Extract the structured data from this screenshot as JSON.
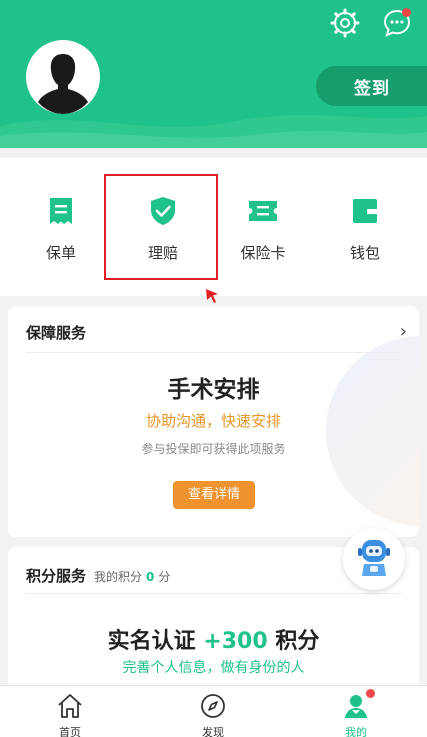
{
  "header": {
    "signin_label": "签到",
    "colors": {
      "background": "#1fc28a",
      "signin_bg": "#179c6c",
      "notify_dot": "#f04848"
    },
    "icons": [
      "settings-icon",
      "chat-icon",
      "avatar-icon"
    ]
  },
  "quick_actions": [
    {
      "label": "保单",
      "icon": "policy-icon"
    },
    {
      "label": "理赔",
      "icon": "claim-shield-icon"
    },
    {
      "label": "保险卡",
      "icon": "insurance-card-icon"
    },
    {
      "label": "钱包",
      "icon": "wallet-icon"
    }
  ],
  "guarantee_card": {
    "heading": "保障服务",
    "title": "手术安排",
    "subtitle": "协助沟通，快速安排",
    "note": "参与投保即可获得此项服务",
    "button_label": "查看详情",
    "arrow": "›"
  },
  "points_card": {
    "heading": "积分服务",
    "my_points_label": "我的积分",
    "points_value": "0",
    "points_unit": "分",
    "title_prefix": "实名认证",
    "title_points": "+300",
    "title_suffix": "积分",
    "subtitle": "完善个人信息，做有身份的人"
  },
  "tabbar": {
    "tabs": [
      {
        "label": "首页",
        "icon": "home-icon"
      },
      {
        "label": "发现",
        "icon": "compass-icon"
      },
      {
        "label": "我的",
        "icon": "user-icon",
        "active": true
      }
    ],
    "active_color": "#1fc28a"
  }
}
